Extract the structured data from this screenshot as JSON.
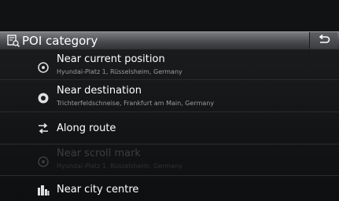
{
  "header": {
    "title": "POI category",
    "title_icon": "poi-category-icon",
    "back_icon": "back-arrow-icon"
  },
  "items": [
    {
      "label": "Near current position",
      "sub": "Hyundai-Platz 1, Rüsselsheim, Germany",
      "icon": "current-position-icon",
      "enabled": true
    },
    {
      "label": "Near destination",
      "sub": "Trichterfeldschneise, Frankfurt am Main, Germany",
      "icon": "destination-icon",
      "enabled": true
    },
    {
      "label": "Along route",
      "sub": "",
      "icon": "route-icon",
      "enabled": true
    },
    {
      "label": "Near scroll mark",
      "sub": "Hyundai-Platz 1, Rüsselsheim, Germany",
      "icon": "scroll-mark-icon",
      "enabled": false
    },
    {
      "label": "Near city centre",
      "sub": "",
      "icon": "city-centre-icon",
      "enabled": true
    }
  ]
}
